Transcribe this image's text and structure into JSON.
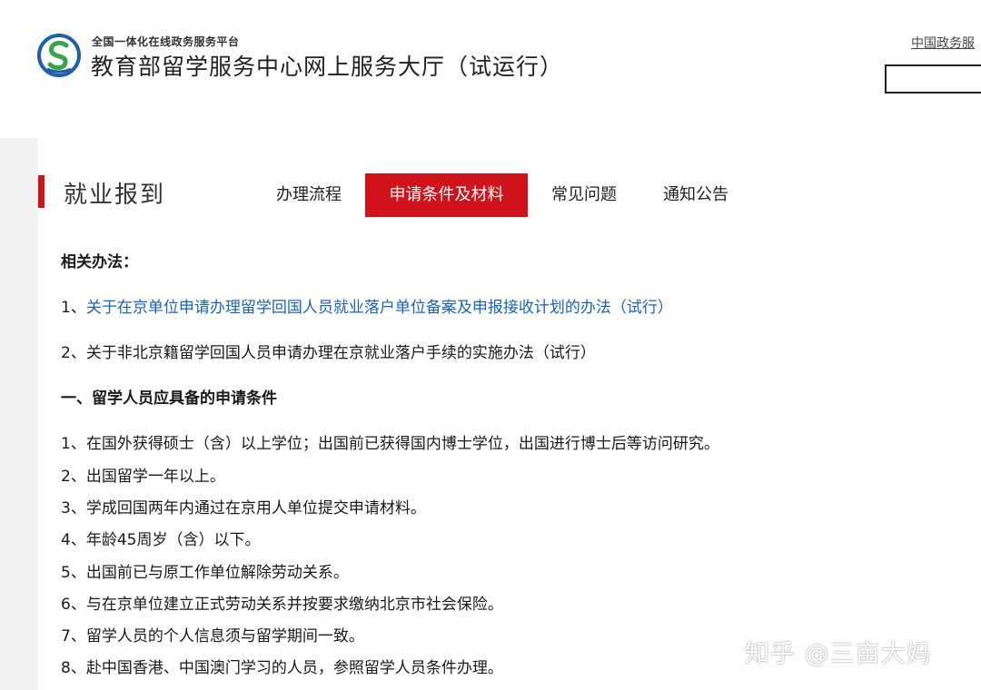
{
  "header": {
    "platform_label": "全国一体化在线政务服务平台",
    "site_title": "教育部留学服务中心网上服务大厅（试运行）",
    "gov_link": "中国政务服"
  },
  "section": {
    "title": "就业报到"
  },
  "tabs": [
    {
      "label": "办理流程",
      "active": false
    },
    {
      "label": "申请条件及材料",
      "active": true
    },
    {
      "label": "常见问题",
      "active": false
    },
    {
      "label": "通知公告",
      "active": false
    }
  ],
  "content": {
    "related_heading": "相关办法：",
    "related_items": [
      "1、关于在京单位申请办理留学回国人员就业落户单位备案及申报接收计划的办法（试行）",
      "2、关于非北京籍留学回国人员申请办理在京就业落户手续的实施办法（试行）"
    ],
    "conditions_heading": "一、留学人员应具备的申请条件",
    "conditions": [
      "1、在国外获得硕士（含）以上学位；出国前已获得国内博士学位，出国进行博士后等访问研究。",
      "2、出国留学一年以上。",
      "3、学成回国两年内通过在京用人单位提交申请材料。",
      "4、年龄45周岁（含）以下。",
      "5、出国前已与原工作单位解除劳动关系。",
      "6、与在京单位建立正式劳动关系并按要求缴纳北京市社会保险。",
      "7、留学人员的个人信息须与留学期间一致。",
      "8、赴中国香港、中国澳门学习的人员，参照留学人员条件办理。"
    ]
  },
  "watermark": "知乎 @三亩大妈",
  "colors": {
    "accent": "#d0121b",
    "link": "#1a63b8",
    "logo_blue": "#1f5fa8",
    "logo_green": "#3aa34a"
  }
}
